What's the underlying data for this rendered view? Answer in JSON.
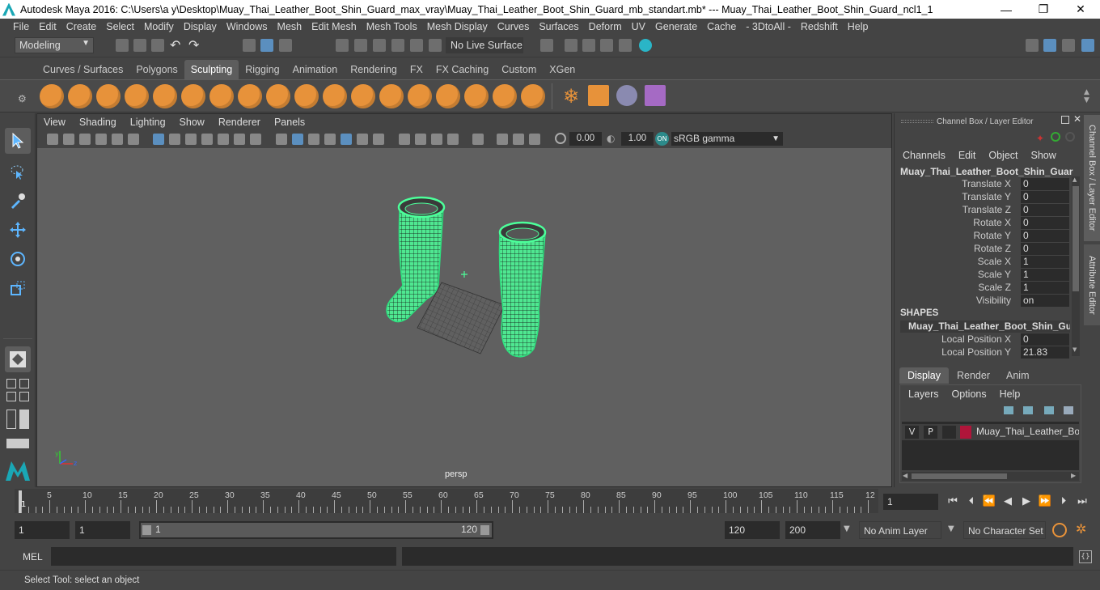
{
  "window": {
    "title": "Autodesk Maya 2016: C:\\Users\\a y\\Desktop\\Muay_Thai_Leather_Boot_Shin_Guard_max_vray\\Muay_Thai_Leather_Boot_Shin_Guard_mb_standart.mb*  ---  Muay_Thai_Leather_Boot_Shin_Guard_ncl1_1",
    "minimize": "—",
    "maximize": "❐",
    "close": "✕"
  },
  "menu": [
    "File",
    "Edit",
    "Create",
    "Select",
    "Modify",
    "Display",
    "Windows",
    "Mesh",
    "Edit Mesh",
    "Mesh Tools",
    "Mesh Display",
    "Curves",
    "Surfaces",
    "Deform",
    "UV",
    "Generate",
    "Cache",
    "- 3DtoAll -",
    "Redshift",
    "Help"
  ],
  "status": {
    "mode": "Modeling",
    "live_surface": "No Live Surface"
  },
  "shelf_tabs": [
    {
      "label": "Curves / Surfaces",
      "active": false
    },
    {
      "label": "Polygons",
      "active": false
    },
    {
      "label": "Sculpting",
      "active": true
    },
    {
      "label": "Rigging",
      "active": false
    },
    {
      "label": "Animation",
      "active": false
    },
    {
      "label": "Rendering",
      "active": false
    },
    {
      "label": "FX",
      "active": false
    },
    {
      "label": "FX Caching",
      "active": false
    },
    {
      "label": "Custom",
      "active": false
    },
    {
      "label": "XGen",
      "active": false
    }
  ],
  "viewport": {
    "menu": [
      "View",
      "Shading",
      "Lighting",
      "Show",
      "Renderer",
      "Panels"
    ],
    "exposure": "0.00",
    "gamma": "1.00",
    "colorspace": "sRGB gamma",
    "camera_label": "persp"
  },
  "channel_box": {
    "panel_title": "Channel Box / Layer Editor",
    "menu": [
      "Channels",
      "Edit",
      "Object",
      "Show"
    ],
    "object_name": "Muay_Thai_Leather_Boot_Shin_Guard...",
    "channels": [
      {
        "label": "Translate X",
        "value": "0"
      },
      {
        "label": "Translate Y",
        "value": "0"
      },
      {
        "label": "Translate Z",
        "value": "0"
      },
      {
        "label": "Rotate X",
        "value": "0"
      },
      {
        "label": "Rotate Y",
        "value": "0"
      },
      {
        "label": "Rotate Z",
        "value": "0"
      },
      {
        "label": "Scale X",
        "value": "1"
      },
      {
        "label": "Scale Y",
        "value": "1"
      },
      {
        "label": "Scale Z",
        "value": "1"
      },
      {
        "label": "Visibility",
        "value": "on"
      }
    ],
    "shapes_header": "SHAPES",
    "shape_name": "Muay_Thai_Leather_Boot_Shin_Guar...",
    "shape_channels": [
      {
        "label": "Local Position X",
        "value": "0"
      },
      {
        "label": "Local Position Y",
        "value": "21.83"
      }
    ],
    "side_tab_1": "Channel Box / Layer Editor",
    "side_tab_2": "Attribute Editor"
  },
  "layer_editor": {
    "tabs": [
      {
        "label": "Display",
        "active": true
      },
      {
        "label": "Render",
        "active": false
      },
      {
        "label": "Anim",
        "active": false
      }
    ],
    "menu": [
      "Layers",
      "Options",
      "Help"
    ],
    "layer": {
      "v": "V",
      "p": "P",
      "name": "Muay_Thai_Leather_Boot",
      "color": "#b0153a"
    }
  },
  "timeline": {
    "ticks": [
      "5",
      "10",
      "15",
      "20",
      "25",
      "30",
      "35",
      "40",
      "45",
      "50",
      "55",
      "60",
      "65",
      "70",
      "75",
      "80",
      "85",
      "90",
      "95",
      "100",
      "105",
      "110",
      "115",
      "12"
    ],
    "start_marker": "1",
    "current_frame": "1"
  },
  "range": {
    "start": "1",
    "playback_start": "1",
    "slider_start": "1",
    "slider_end": "120",
    "playback_end": "120",
    "end": "200",
    "anim_layer": "No Anim Layer",
    "character_set": "No Character Set"
  },
  "command": {
    "mel_label": "MEL"
  },
  "help_line": "Select Tool: select an object",
  "colors": {
    "accent_green": "#4cff9a",
    "shelf_orange": "#e7923a",
    "active_blue": "#5b8fbf",
    "layer_red": "#b0153a"
  }
}
